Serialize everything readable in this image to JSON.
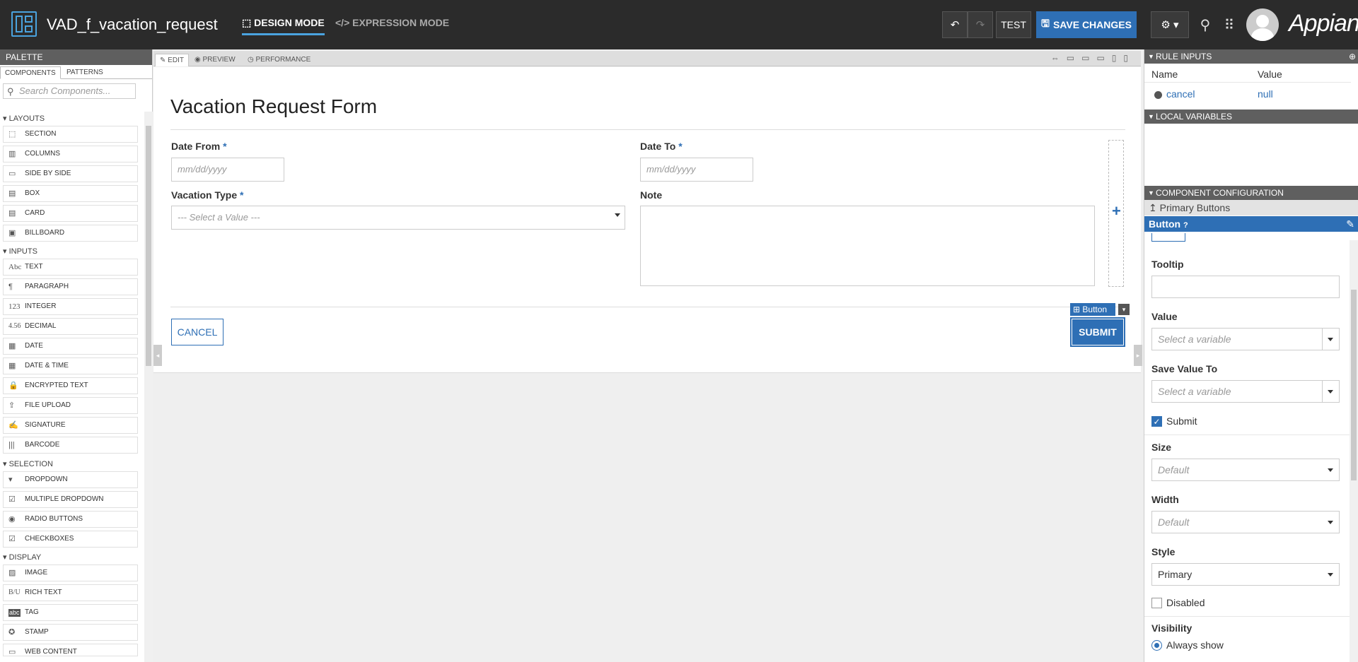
{
  "topbar": {
    "title": "VAD_f_vacation_request",
    "design_mode": "DESIGN MODE",
    "expression_mode": "EXPRESSION MODE",
    "undo_icon": "undo-icon",
    "redo_icon": "redo-icon",
    "test_label": "TEST",
    "save_label": "SAVE CHANGES",
    "logo": "Appian",
    "accent_color": "#2e6fb5"
  },
  "palette": {
    "header": "PALETTE",
    "tabs": [
      "COMPONENTS",
      "PATTERNS"
    ],
    "search_placeholder": "Search Components...",
    "categories": {
      "layouts": "LAYOUTS",
      "inputs": "INPUTS",
      "selection": "SELECTION",
      "display": "DISPLAY"
    },
    "layouts": [
      "SECTION",
      "COLUMNS",
      "SIDE BY SIDE",
      "BOX",
      "CARD",
      "BILLBOARD"
    ],
    "inputs": [
      "TEXT",
      "PARAGRAPH",
      "INTEGER",
      "DECIMAL",
      "DATE",
      "DATE & TIME",
      "ENCRYPTED TEXT",
      "FILE UPLOAD",
      "SIGNATURE",
      "BARCODE"
    ],
    "selection": [
      "DROPDOWN",
      "MULTIPLE DROPDOWN",
      "RADIO BUTTONS",
      "CHECKBOXES"
    ],
    "display": [
      "IMAGE",
      "RICH TEXT",
      "TAG",
      "STAMP",
      "WEB CONTENT"
    ],
    "icon_text": {
      "text": "Abc",
      "integer": "123",
      "decimal": "4.56",
      "rich": "B/U",
      "tag": "abc"
    }
  },
  "canvas": {
    "tabs": [
      "EDIT",
      "PREVIEW",
      "PERFORMANCE"
    ],
    "form": {
      "title": "Vacation Request Form",
      "date_from_label": "Date From",
      "date_to_label": "Date To",
      "required_mark": "*",
      "date_placeholder": "mm/dd/yyyy",
      "vacation_type_label": "Vacation Type",
      "vacation_type_placeholder": "--- Select a Value ---",
      "note_label": "Note",
      "cancel_label": "CANCEL",
      "submit_label": "SUBMIT",
      "selected_tag": "Button"
    }
  },
  "right_panel": {
    "rule_inputs_header": "RULE INPUTS",
    "col_name": "Name",
    "col_value": "Value",
    "rule_input_name": "cancel",
    "rule_input_value": "null",
    "local_variables_header": "LOCAL VARIABLES",
    "component_config_header": "COMPONENT CONFIGURATION",
    "breadcrumb_parent": "Primary Buttons",
    "breadcrumb_current": "Button",
    "tooltip_label": "Tooltip",
    "value_label": "Value",
    "value_placeholder": "Select a variable",
    "save_value_to_label": "Save Value To",
    "save_value_to_placeholder": "Select a variable",
    "submit_label": "Submit",
    "submit_checked": true,
    "size_label": "Size",
    "size_value": "Default",
    "width_label": "Width",
    "width_value": "Default",
    "style_label": "Style",
    "style_value": "Primary",
    "disabled_label": "Disabled",
    "disabled_checked": false,
    "visibility_label": "Visibility",
    "visibility_option": "Always show"
  }
}
